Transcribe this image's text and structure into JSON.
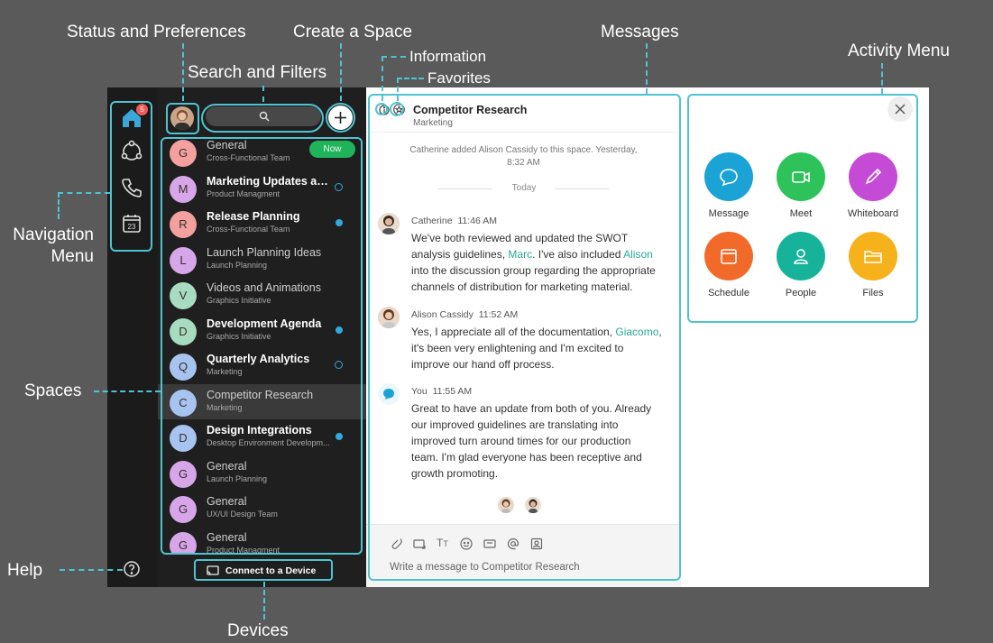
{
  "annotations": {
    "status": "Status and Preferences",
    "create": "Create a Space",
    "search": "Search and Filters",
    "information": "Information",
    "favorites": "Favorites",
    "messages": "Messages",
    "activity": "Activity Menu",
    "navigation_l1": "Navigation",
    "navigation_l2": "Menu",
    "spaces": "Spaces",
    "help": "Help",
    "devices": "Devices"
  },
  "nav": {
    "badge": "5",
    "calendar_day": "23"
  },
  "spaces": [
    {
      "initial": "G",
      "title": "General",
      "subtitle": "Cross-Functional Team",
      "bold": false,
      "color": "#f4a0a0",
      "indicator": "now"
    },
    {
      "initial": "M",
      "title": "Marketing Updates and...",
      "subtitle": "Product Managment",
      "bold": true,
      "color": "#d7a6e8",
      "indicator": "ring"
    },
    {
      "initial": "R",
      "title": "Release Planning",
      "subtitle": "Cross-Functional Team",
      "bold": true,
      "color": "#f4a0a0",
      "indicator": "dot"
    },
    {
      "initial": "L",
      "title": "Launch Planning Ideas",
      "subtitle": "Launch Planning",
      "bold": false,
      "color": "#d7a6e8",
      "indicator": ""
    },
    {
      "initial": "V",
      "title": "Videos and Animations",
      "subtitle": "Graphics Initiative",
      "bold": false,
      "color": "#a8dcc0",
      "indicator": ""
    },
    {
      "initial": "D",
      "title": "Development Agenda",
      "subtitle": "Graphics Initiative",
      "bold": true,
      "color": "#a8dcc0",
      "indicator": "dot"
    },
    {
      "initial": "Q",
      "title": "Quarterly Analytics",
      "subtitle": "Marketing",
      "bold": true,
      "color": "#a7c4f0",
      "indicator": "ring"
    },
    {
      "initial": "C",
      "title": "Competitor Research",
      "subtitle": "Marketing",
      "bold": false,
      "color": "#a7c4f0",
      "indicator": "",
      "selected": true
    },
    {
      "initial": "D",
      "title": "Design Integrations",
      "subtitle": "Desktop Environment Developm...",
      "bold": true,
      "color": "#a7c4f0",
      "indicator": "dot"
    },
    {
      "initial": "G",
      "title": "General",
      "subtitle": "Launch Planning",
      "bold": false,
      "color": "#d7a6e8",
      "indicator": ""
    },
    {
      "initial": "G",
      "title": "General",
      "subtitle": "UX/UI Design Team",
      "bold": false,
      "color": "#d7a6e8",
      "indicator": ""
    },
    {
      "initial": "G",
      "title": "General",
      "subtitle": "Product Managment",
      "bold": false,
      "color": "#d7a6e8",
      "indicator": ""
    }
  ],
  "now_label": "Now",
  "connect_label": "Connect to a Device",
  "space_header": {
    "title": "Competitor Research",
    "subtitle": "Marketing"
  },
  "system_msg_l1": "Catherine added Alison Cassidy to this space. Yesterday,",
  "system_msg_l2": "8:32 AM",
  "today": "Today",
  "messages": [
    {
      "name": "Catherine",
      "time": "11:46 AM",
      "lines": [
        [
          "We've both reviewed and updated the SWOT"
        ],
        [
          "analysis guidelines, ",
          "Marc",
          ". I've also included ",
          "Alison"
        ],
        [
          "into the discussion group regarding the appropriate"
        ],
        [
          "channels of distribution for marketing material."
        ]
      ]
    },
    {
      "name": "Alison Cassidy",
      "time": "11:52 AM",
      "lines": [
        [
          "Yes, I appreciate all of the documentation, ",
          "Giacomo",
          ","
        ],
        [
          "it's been very enlightening and I'm excited to"
        ],
        [
          "improve our hand off process."
        ]
      ]
    },
    {
      "name": "You",
      "time": "11:55 AM",
      "lines": [
        [
          "Great to have an update from both of you. Already"
        ],
        [
          "our improved guidelines are translating into"
        ],
        [
          "improved turn around times for our production"
        ],
        [
          "team. I'm glad everyone has been receptive and"
        ],
        [
          "growth promoting."
        ]
      ]
    }
  ],
  "composer_placeholder": "Write a message to Competitor Research",
  "activity_items": [
    {
      "label": "Message",
      "color": "#1ba3d6"
    },
    {
      "label": "Meet",
      "color": "#2ec35a"
    },
    {
      "label": "Whiteboard",
      "color": "#c54ad6"
    },
    {
      "label": "Schedule",
      "color": "#f26a2a"
    },
    {
      "label": "People",
      "color": "#16b39a"
    },
    {
      "label": "Files",
      "color": "#f5b21b"
    }
  ],
  "accent": "#4fc3d0"
}
